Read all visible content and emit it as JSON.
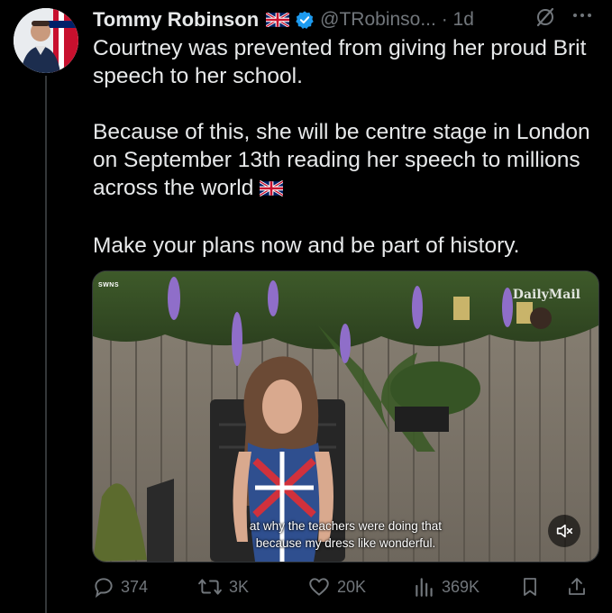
{
  "author": {
    "name": "Tommy Robinson",
    "handle": "@TRobinso...",
    "time_sep": " · ",
    "time": "1d",
    "flag_icon": "uk-flag-icon",
    "verified_icon": "verified-badge-icon",
    "verified_color": "#1d9bf0"
  },
  "tweet": {
    "paragraphs": [
      "Courtney was prevented from giving her proud Brit speech to her school.",
      "Because of this, she will be centre stage in London on September 13th reading her speech to millions across the world",
      "Make your plans now and be part of history."
    ]
  },
  "media": {
    "source_tag": "SWNS",
    "watermark": "DailyMail",
    "caption_line1": "at why the teachers were doing that",
    "caption_line2": "because my dress like wonderful.",
    "mute_icon": "muted-speaker-icon"
  },
  "actions": {
    "replies": "374",
    "reposts": "3K",
    "likes": "20K",
    "views": "369K"
  },
  "colors": {
    "background": "#000000",
    "text": "#e7e9ea",
    "muted": "#71767b",
    "accent": "#1d9bf0"
  }
}
